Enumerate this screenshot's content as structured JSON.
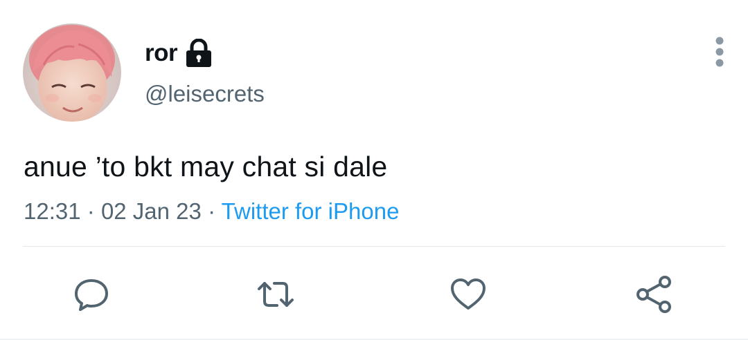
{
  "tweet": {
    "display_name": "ror",
    "handle": "@leisecrets",
    "protected_icon": "lock-icon",
    "text": "anue ’to bkt may chat si dale",
    "time": "12:31",
    "separator": "·",
    "date": "02 Jan 23",
    "source": "Twitter for iPhone"
  },
  "actions": {
    "reply_icon": "speech-bubble-icon",
    "retweet_icon": "retweet-icon",
    "like_icon": "heart-icon",
    "share_icon": "share-icon"
  },
  "more_icon": "vertical-ellipsis-icon",
  "colors": {
    "text_primary": "#0f1419",
    "text_secondary": "#536471",
    "link": "#1d9bf0",
    "icon": "#536471",
    "divider": "#e6e9ec"
  }
}
